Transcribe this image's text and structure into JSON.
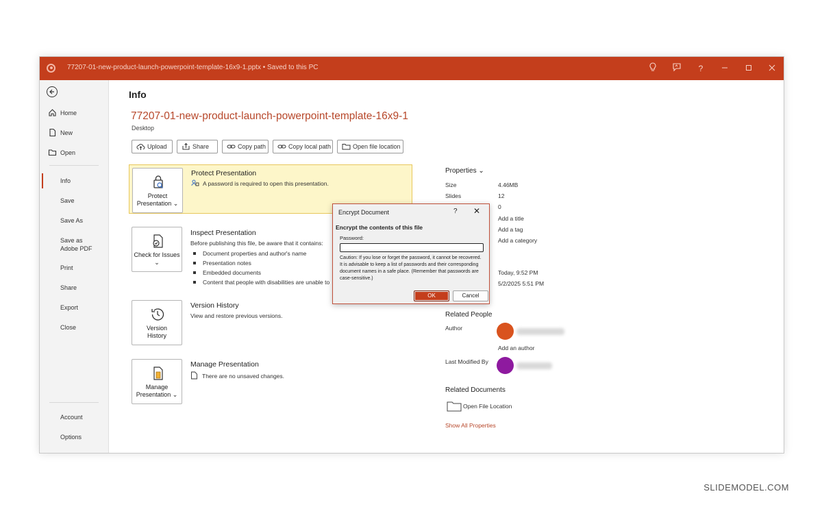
{
  "titlebar": {
    "document_title": "77207-01-new-product-launch-powerpoint-template-16x9-1.pptx • Saved to this PC",
    "accent_color": "#c43e1c"
  },
  "sidebar": {
    "items": [
      {
        "label": "Home",
        "icon": "home-icon"
      },
      {
        "label": "New",
        "icon": "new-document-icon"
      },
      {
        "label": "Open",
        "icon": "open-folder-icon"
      },
      {
        "label": "Info",
        "active": true
      },
      {
        "label": "Save"
      },
      {
        "label": "Save As"
      },
      {
        "label": "Save as Adobe PDF"
      },
      {
        "label": "Print"
      },
      {
        "label": "Share"
      },
      {
        "label": "Export"
      },
      {
        "label": "Close"
      },
      {
        "label": "Account"
      },
      {
        "label": "Options"
      }
    ]
  },
  "main": {
    "title": "Info",
    "file_name": "77207-01-new-product-launch-powerpoint-template-16x9-1",
    "file_location": "Desktop",
    "actions": [
      {
        "label": "Upload",
        "icon": "cloud-upload-icon"
      },
      {
        "label": "Share",
        "icon": "share-icon"
      },
      {
        "label": "Copy path",
        "icon": "link-icon"
      },
      {
        "label": "Copy local path",
        "icon": "link-icon"
      },
      {
        "label": "Open file location",
        "icon": "folder-icon"
      }
    ],
    "protect": {
      "tile_label": "Protect Presentation",
      "title": "Protect Presentation",
      "desc": "A password is required to open this presentation."
    },
    "inspect": {
      "tile_label": "Check for Issues",
      "title": "Inspect Presentation",
      "desc": "Before publishing this file, be aware that it contains:",
      "bullets": [
        "Document properties and author's name",
        "Presentation notes",
        "Embedded documents",
        "Content that people with disabilities are unable to"
      ]
    },
    "version": {
      "tile_label": "Version History",
      "title": "Version History",
      "desc": "View and restore previous versions."
    },
    "manage": {
      "tile_label": "Manage Presentation",
      "title": "Manage Presentation",
      "desc": "There are no unsaved changes."
    }
  },
  "properties": {
    "heading": "Properties",
    "rows": [
      {
        "label": "Size",
        "value": "4.46MB"
      },
      {
        "label": "Slides",
        "value": "12"
      },
      {
        "label": "",
        "value": "0"
      }
    ],
    "add_title": "Add a title",
    "add_tag": "Add a tag",
    "add_category": "Add a category",
    "date1": "Today, 9:52 PM",
    "date2": "5/2/2025 5:51 PM",
    "related_people": "Related People",
    "author_label": "Author",
    "add_author": "Add an author",
    "last_modified_label": "Last Modified By",
    "related_documents": "Related Documents",
    "open_file_location": "Open File Location",
    "show_all": "Show All Properties",
    "author_avatar_color": "#d9531e",
    "modifier_avatar_color": "#8e1a9f"
  },
  "dialog": {
    "title": "Encrypt Document",
    "help": "?",
    "close": "✕",
    "heading": "Encrypt the contents of this file",
    "password_label": "Password:",
    "password_value": "",
    "caution": "Caution: If you lose or forget the password, it cannot be recovered. It is advisable to keep a list of passwords and their corresponding document names in a safe place. (Remember that passwords are case-sensitive.)",
    "ok_label": "OK",
    "cancel_label": "Cancel"
  },
  "watermark": "SLIDEMODEL.COM"
}
